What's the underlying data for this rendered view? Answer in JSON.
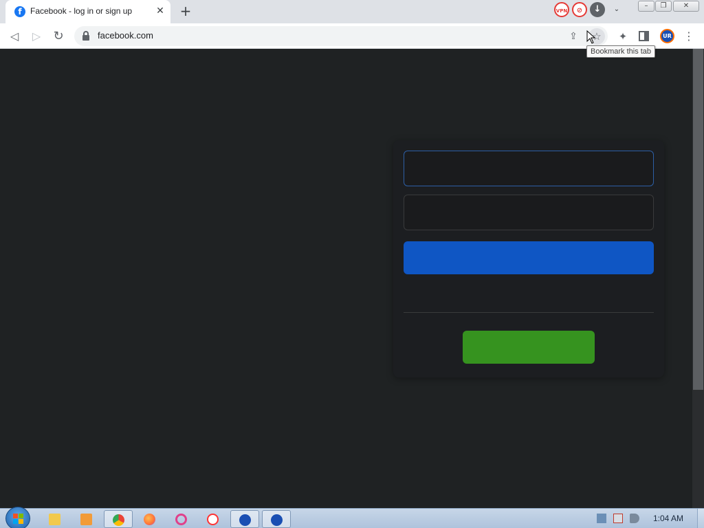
{
  "browser": {
    "tab": {
      "title": "Facebook - log in or sign up",
      "favicon": "f",
      "close_glyph": "✕"
    },
    "new_tab_glyph": "+",
    "extensions": [
      {
        "name": "vpn-extension-icon",
        "label": "VPN"
      },
      {
        "name": "mask-extension-icon",
        "label": "⊘"
      },
      {
        "name": "download-extension-icon",
        "label": "↓"
      }
    ],
    "tab_search_glyph": "⌄",
    "window_controls": {
      "minimize": "–",
      "maximize": "❐",
      "close": "✕"
    },
    "nav": {
      "back": "◁",
      "forward": "▷",
      "reload": "↻"
    },
    "address": "facebook.com",
    "toolbar_icons": {
      "share": "⇪",
      "star": "☆",
      "extensions": "✦",
      "profile": "UR",
      "menu": "⋮"
    },
    "tooltip": "Bookmark this tab"
  },
  "page": {
    "email_field": {
      "value": "",
      "placeholder": ""
    },
    "password_field": {
      "value": "",
      "placeholder": ""
    },
    "login_button": "",
    "create_account_button": ""
  },
  "taskbar": {
    "items": [
      {
        "name": "taskbar-explorer",
        "icon": "folder-icon",
        "color": "#f2c94c"
      },
      {
        "name": "taskbar-media-player",
        "icon": "media-player-icon",
        "color": "#f29b38"
      },
      {
        "name": "taskbar-chrome",
        "icon": "chrome-icon",
        "color": "#4caf50"
      },
      {
        "name": "taskbar-firefox",
        "icon": "firefox-icon",
        "color": "#ff7139"
      },
      {
        "name": "taskbar-opera",
        "icon": "opera-icon",
        "color": "#e0408a"
      },
      {
        "name": "taskbar-yandex",
        "icon": "yandex-icon",
        "color": "#ff3333"
      },
      {
        "name": "taskbar-ur-browser-1",
        "icon": "ur-browser-icon",
        "color": "#1a4fb3"
      },
      {
        "name": "taskbar-ur-browser-2",
        "icon": "ur-browser-icon",
        "color": "#1a4fb3"
      }
    ],
    "clock": "1:04 AM"
  },
  "colors": {
    "page_background": "#1f2223",
    "login_button": "#0f56c4",
    "create_account_button": "#36931f",
    "facebook_blue": "#1877f2"
  }
}
